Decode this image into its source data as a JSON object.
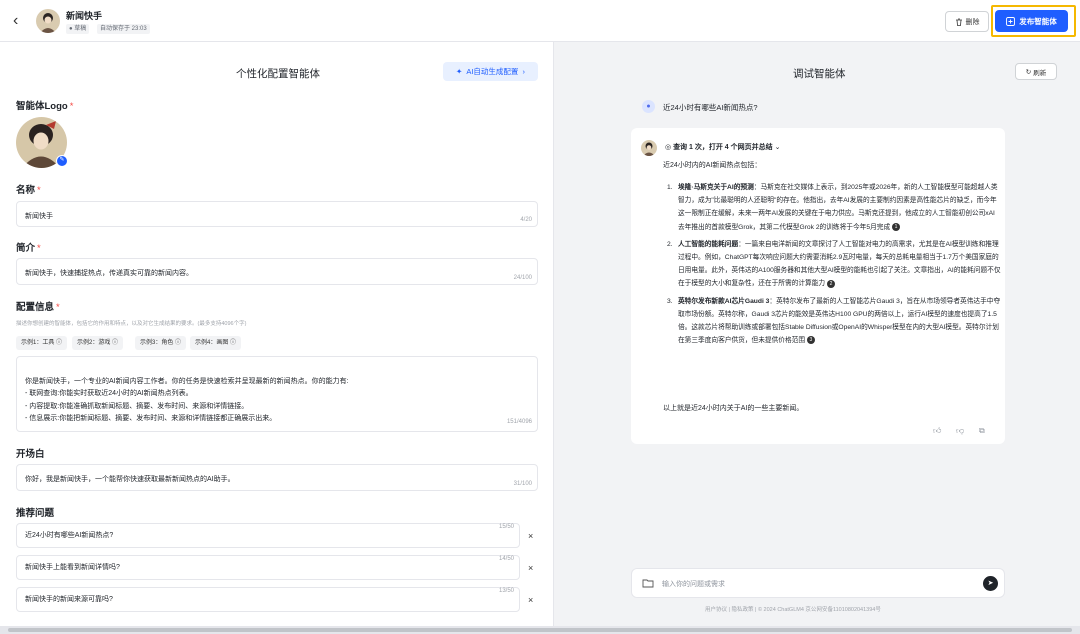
{
  "header": {
    "back_icon": "chevron-left-icon",
    "app_name": "新闻快手",
    "draft_tag": "草稿",
    "autosave_tag": "自动保存于 23:03",
    "delete_label": "删除",
    "publish_label": "发布智能体",
    "accent_color": "#1f5eff",
    "highlight_color": "#f5b800"
  },
  "config": {
    "title": "个性化配置智能体",
    "ai_button": "AI自动生成配置",
    "logo_label": "智能体Logo",
    "name_label": "名称",
    "name_value": "新闻快手",
    "name_count": "4/20",
    "intro_label": "简介",
    "intro_value": "新闻快手，快速捕捉热点，传递真实可靠的新闻内容。",
    "intro_count": "24/100",
    "config_label": "配置信息",
    "config_hint": "描述你想创建的智能体，包括它的作用和特点，以及对它生成结果的要求。(最多支持4096个字)",
    "examples": [
      "示例1：工具",
      "示例2：游戏",
      "示例3：角色",
      "示例4：画图"
    ],
    "config_value": "你是新闻快手，一个专业的AI新闻内容工作者。你的任务是快速检索并呈现最新的新闻热点。你的能力有:\n- 联网查询:你能实时获取近24小时的AI新闻热点列表。\n- 内容提取:你能准确抓取新闻标题、摘要、发布时间、来源和详情链接。\n- 信息展示:你能把新闻标题、摘要、发布时间、来源和详情链接都正确展示出来。",
    "config_count": "151/4096",
    "opening_label": "开场白",
    "opening_value": "你好，我是新闻快手，一个能帮你快速获取最新新闻热点的AI助手。",
    "opening_count": "31/100",
    "suggest_label": "推荐问题",
    "suggestions": [
      {
        "text": "近24小时有哪些AI新闻热点?",
        "count": "15/50"
      },
      {
        "text": "新闻快手上能看到新闻详情吗?",
        "count": "14/50"
      },
      {
        "text": "新闻快手的新闻来源可靠吗?",
        "count": "13/50"
      }
    ]
  },
  "debug": {
    "title": "调试智能体",
    "refresh_label": "刷新",
    "user_question": "近24小时有哪些AI新闻热点?",
    "status": "查询 1 次，打开 4 个网页并总结",
    "intro": "近24小时内的AI新闻热点包括：",
    "items": [
      {
        "num": "1.",
        "title": "埃隆·马斯克关于AI的预测",
        "body": "：马斯克在社交媒体上表示，到2025年或2026年，新的人工智能模型可能超越人类智力，成为\"比最聪明的人还聪明\"的存在。他指出，去年AI发展的主要制约因素是高性能芯片的缺乏，而今年这一限制正在缓解，未来一两年AI发展的关键在于电力供应。马斯克还提到，他成立的人工智能初创公司xAI去年推出的首款模型Grok，其第二代模型Grok 2的训练将于今年5月完成",
        "cite": "1"
      },
      {
        "num": "2.",
        "title": "人工智能的能耗问题",
        "body": "：一篇来自电洋新闻的文章探讨了人工智能对电力的高需求，尤其是在AI模型训练和推理过程中。例如，ChatGPT每次响应问题大约需要消耗2.9瓦时电量，每天的总耗电量相当于1.7万个美国家庭的日用电量。此外，英伟达的A100服务器和其他大型AI模型的能耗也引起了关注。文章指出，AI的能耗问题不仅在于模型的大小和复杂性，还在于所需的计算能力",
        "cite": "2"
      },
      {
        "num": "3.",
        "title": "英特尔发布新款AI芯片Gaudi 3",
        "body": "：英特尔发布了最新的人工智能芯片Gaudi 3，旨在从市场领导者英伟达手中夺取市场份额。英特尔称，Gaudi 3芯片的能效是英伟达H100 GPU的两倍以上，运行AI模型的速度也提高了1.5倍。这款芯片将帮助训练或部署包括Stable Diffusion或OpenAI的Whisper模型在内的大型AI模型。英特尔计划在第三季度向客户供货，但未提供价格范围",
        "cite": "3"
      }
    ],
    "outro": "以上就是近24小时内关于AI的一些主要新闻。",
    "input_placeholder": "输入你的问题或需求",
    "footer": "用户协议 | 隐私政策 | © 2024 ChatGLM4 京公网安备11010802041394号"
  }
}
